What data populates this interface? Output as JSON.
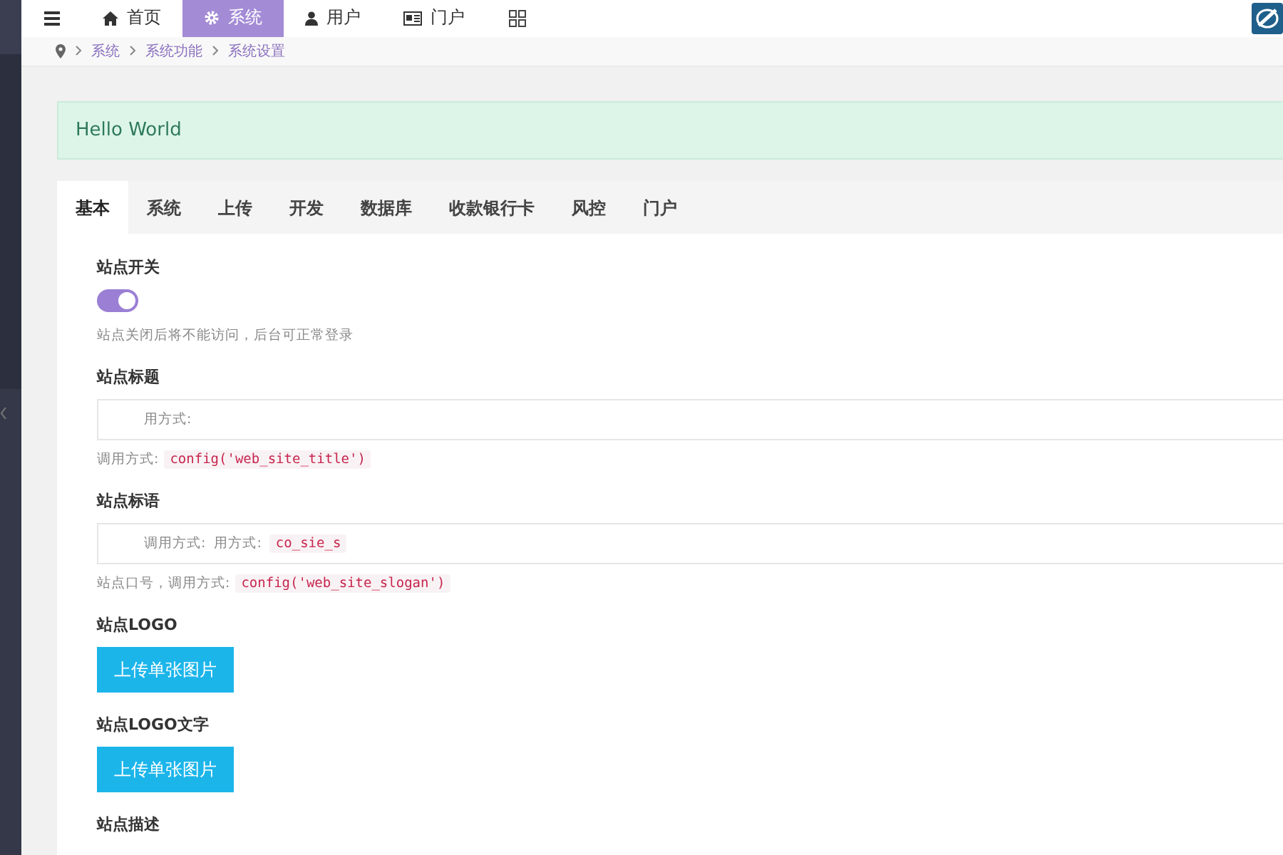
{
  "topnav": {
    "items": [
      {
        "label": "首页",
        "selected": false
      },
      {
        "label": "系统",
        "selected": true
      },
      {
        "label": "用户",
        "selected": false
      },
      {
        "label": "门户",
        "selected": false
      }
    ]
  },
  "breadcrumb": [
    "系统",
    "系统功能",
    "系统设置"
  ],
  "alert": "Hello World",
  "tabs": [
    {
      "label": "基本",
      "selected": true
    },
    {
      "label": "系统",
      "selected": false
    },
    {
      "label": "上传",
      "selected": false
    },
    {
      "label": "开发",
      "selected": false
    },
    {
      "label": "数据库",
      "selected": false
    },
    {
      "label": "收款银行卡",
      "selected": false
    },
    {
      "label": "风控",
      "selected": false
    },
    {
      "label": "门户",
      "selected": false
    }
  ],
  "fields": [
    {
      "kind": "switch",
      "label": "站点开关",
      "on": true,
      "help": "站点关闭后将不能访问，后台可正常登录"
    },
    {
      "kind": "text",
      "label": "站点标题",
      "placeholder": "用方式:",
      "help": "调用方式:",
      "help_code": "config('web_site_title')"
    },
    {
      "kind": "text",
      "label": "站点标语",
      "ghost": [
        "调用方式:",
        "用方式:"
      ],
      "ghost_code": "co_sie_s",
      "help": "站点口号，调用方式:",
      "help_code": "config('web_site_slogan')"
    },
    {
      "kind": "image",
      "label": "站点LOGO",
      "button": "上传单张图片"
    },
    {
      "kind": "image",
      "label": "站点LOGO文字",
      "button": "上传单张图片"
    },
    {
      "kind": "label",
      "label": "站点描述"
    }
  ]
}
